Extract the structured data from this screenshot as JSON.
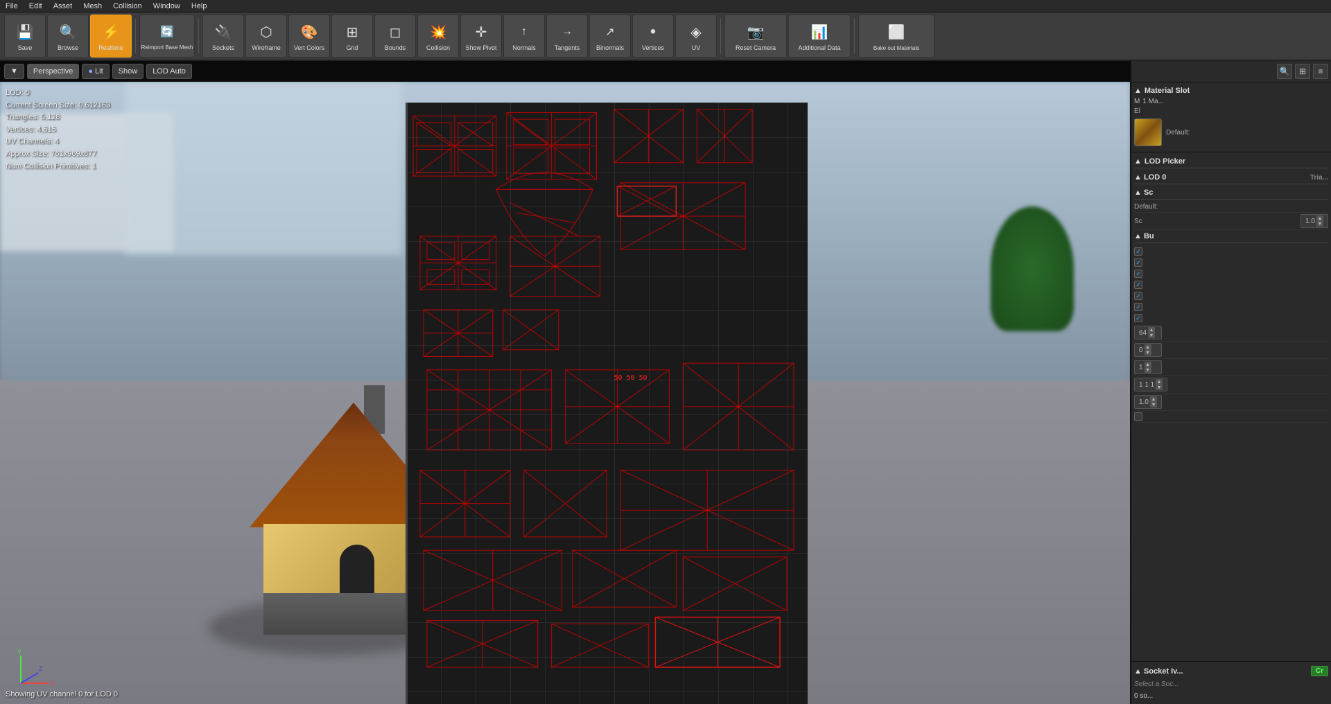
{
  "menubar": {
    "items": [
      "File",
      "Edit",
      "Asset",
      "Mesh",
      "Collision",
      "Window",
      "Help"
    ]
  },
  "toolbar": {
    "buttons": [
      {
        "id": "save",
        "label": "Save",
        "icon": "💾",
        "active": false
      },
      {
        "id": "browse",
        "label": "Browse",
        "icon": "🔍",
        "active": false
      },
      {
        "id": "realtime",
        "label": "Realtime",
        "icon": "⚡",
        "active": true
      },
      {
        "id": "reimport",
        "label": "Reimport Base Mesh",
        "icon": "🔄",
        "active": false,
        "wide": true
      },
      {
        "id": "sockets",
        "label": "Sockets",
        "icon": "🔌",
        "active": false
      },
      {
        "id": "wireframe",
        "label": "Wireframe",
        "icon": "⬡",
        "active": false
      },
      {
        "id": "vertcolors",
        "label": "Vert Colors",
        "icon": "🎨",
        "active": false
      },
      {
        "id": "grid",
        "label": "Grid",
        "icon": "⊞",
        "active": false
      },
      {
        "id": "bounds",
        "label": "Bounds",
        "icon": "◻",
        "active": false
      },
      {
        "id": "collision",
        "label": "Collision",
        "icon": "💥",
        "active": false
      },
      {
        "id": "showpivot",
        "label": "Show Pivot",
        "icon": "✛",
        "active": false
      },
      {
        "id": "normals",
        "label": "Normals",
        "icon": "↑",
        "active": false
      },
      {
        "id": "tangents",
        "label": "Tangents",
        "icon": "→",
        "active": false
      },
      {
        "id": "binormals",
        "label": "Binormals",
        "icon": "↗",
        "active": false
      },
      {
        "id": "vertices",
        "label": "Vertices",
        "icon": "•",
        "active": false
      },
      {
        "id": "uv",
        "label": "UV",
        "icon": "◈",
        "active": false
      },
      {
        "id": "resetcamera",
        "label": "Reset Camera",
        "icon": "📷",
        "active": false
      },
      {
        "id": "additionaldata",
        "label": "Additional Data",
        "icon": "📊",
        "active": false
      },
      {
        "id": "bakeout",
        "label": "Bake out Materials",
        "icon": "⬜",
        "active": false,
        "wide": true
      }
    ]
  },
  "viewport": {
    "perspective_label": "Perspective",
    "lit_label": "Lit",
    "show_label": "Show",
    "lod_auto_label": "LOD Auto",
    "stats": {
      "lod": "LOD: 0",
      "screen_size": "Current Screen Size: 0.612163",
      "triangles": "Triangles:  5,128",
      "vertices": "Vertices:  4,515",
      "uv_channels": "UV Channels:  4",
      "approx_size": "Approx Size: 761x969x877",
      "num_collision": "Num Collision Primitives: 1"
    },
    "uv_channel_info": "Showing UV channel 0 for LOD 0"
  },
  "right_panel": {
    "material_slot": {
      "section_title": "Material Slot",
      "index_label": "M",
      "slot_label": "1 Ma...",
      "element_label": "El",
      "slot_value_label": "Default:"
    },
    "lod_picker": {
      "section_title": "LOD Picker",
      "lod_label": "▲ LOD 0",
      "info_label": "Tria...",
      "section_sub": "▲ Sc",
      "default_label": "Default:",
      "scale_label": "Sc",
      "scale_value": "1.0",
      "bulk_label": "▲ Bu",
      "checkboxes": [
        "",
        "",
        "",
        "",
        "",
        "",
        ""
      ],
      "value_64": "64",
      "value_0": "0",
      "value_1": "1",
      "value_111": "1 1 1",
      "value_10": "1.0"
    },
    "socket": {
      "section_title": "Socket Iv...",
      "create_label": "Cr",
      "empty_label": "Select a Soc...",
      "socket_bar_label": "0 so..."
    }
  }
}
